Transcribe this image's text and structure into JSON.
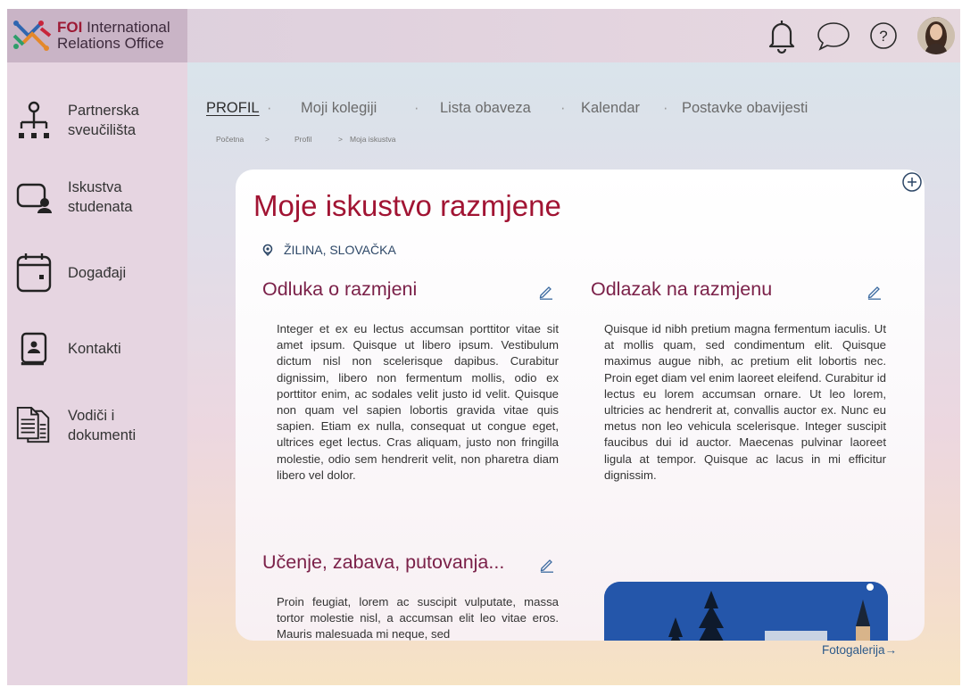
{
  "brand": {
    "foi": "FOI",
    "line1_rest": "International",
    "line2": "Relations Office"
  },
  "topbar": {
    "icons": [
      "bell-icon",
      "chat-bubble-icon",
      "help-icon"
    ],
    "avatar": "user-avatar"
  },
  "sidebar": {
    "items": [
      {
        "icon": "hierarchy-icon",
        "line1": "Partnerska",
        "line2": "sveučilišta"
      },
      {
        "icon": "user-card-icon",
        "line1": "Iskustva",
        "line2": "studenata"
      },
      {
        "icon": "calendar-icon",
        "line1": "Događaji",
        "line2": ""
      },
      {
        "icon": "contact-book-icon",
        "line1": "Kontakti",
        "line2": ""
      },
      {
        "icon": "documents-icon",
        "line1": "Vodiči i",
        "line2": "dokumenti"
      }
    ]
  },
  "nav": {
    "tabs": [
      "PROFIL",
      "Moji kolegiji",
      "Lista obaveza",
      "Kalendar",
      "Postavke obavijesti"
    ],
    "separator": "·"
  },
  "breadcrumb": {
    "items": [
      "Početna",
      "Profil",
      "Moja iskustva"
    ],
    "separator": ">"
  },
  "card": {
    "title": "Moje iskustvo razmjene",
    "location": "ŽILINA, SLOVAČKA",
    "sections": [
      {
        "title": "Odluka o razmjeni",
        "text": "Integer et ex eu lectus accumsan porttitor vitae sit amet ipsum. Quisque ut libero ipsum. Vestibulum dictum nisl non scelerisque dapibus. Curabitur dignissim, libero non fermentum mollis, odio ex porttitor enim, ac sodales velit justo id velit. Quisque non quam vel sapien lobortis gravida vitae quis sapien. Etiam ex nulla, consequat ut congue eget, ultrices eget lectus. Cras aliquam, justo non fringilla molestie, odio sem hendrerit velit, non pharetra diam libero vel dolor."
      },
      {
        "title": "Odlazak na razmjenu",
        "text": "Quisque id nibh pretium magna fermentum iaculis. Ut at mollis quam, sed condimentum elit. Quisque maximus augue nibh, ac pretium elit lobortis nec. Proin eget diam vel enim laoreet eleifend. Curabitur id lectus eu lorem accumsan ornare. Ut leo lorem, ultricies ac hendrerit at, convallis auctor ex. Nunc eu metus non leo vehicula scelerisque. Integer suscipit faucibus dui id auctor. Maecenas pulvinar laoreet ligula at tempor. Quisque ac lacus in mi efficitur dignissim."
      },
      {
        "title": "Učenje, zabava, putovanja...",
        "text": "Proin feugiat, lorem ac suscipit vulputate, massa tortor molestie nisl, a accumsan elit leo vitae eros. Mauris malesuada mi neque, sed"
      }
    ]
  },
  "gallery_link": "Fotogalerija",
  "gallery_arrow": "→",
  "colors": {
    "accent": "#a11433",
    "section_title": "#7b2149",
    "link": "#2d5a8a",
    "sidebar": "#e6d5e1",
    "brand_bg": "#c9b4c6"
  }
}
